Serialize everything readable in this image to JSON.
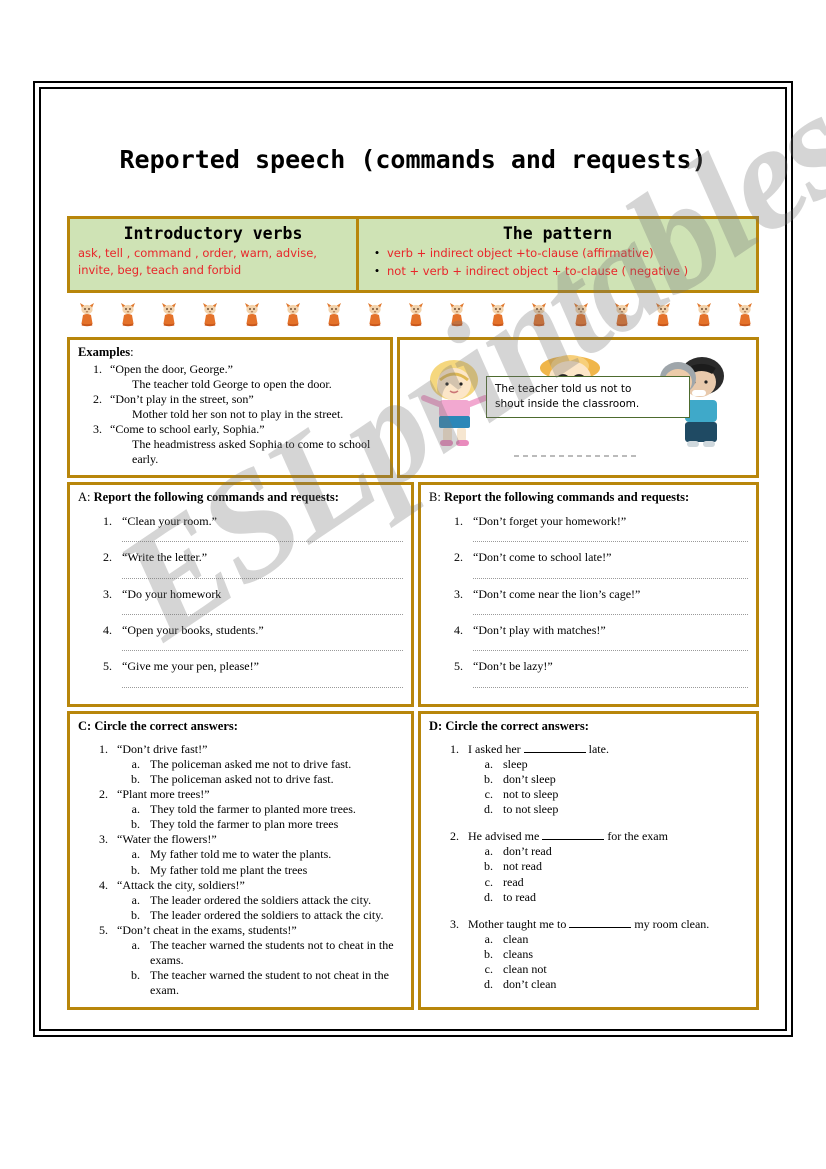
{
  "title": "Reported speech (commands and requests)",
  "watermark": "ESLprintables.com",
  "intro": {
    "verbs_heading": "Introductory verbs",
    "verbs_line1": "ask, tell , command , order, warn, advise,",
    "verbs_line2": "invite, beg, teach and forbid",
    "pattern_heading": "The pattern",
    "pattern_1": "verb + indirect object +to-clause (affirmative)",
    "pattern_2": "not + verb + indirect object + to-clause ( negative )",
    "bullet": "•",
    "verbs_color": "#e8262a",
    "box_bg": "#cfe3b5",
    "border_color": "#b8860b"
  },
  "examples": {
    "heading": "Examples",
    "heading_colon": ":",
    "items": [
      {
        "num": "1.",
        "quote": "“Open the door, George.”",
        "answer": "The teacher told George to open the door."
      },
      {
        "num": "2.",
        "quote": "“Don’t play in the street, son”",
        "answer": "Mother told her son not to play in the street."
      },
      {
        "num": "3.",
        "quote": "“Come to school early, Sophia.”",
        "answer": "The headmistress asked Sophia to come to school early."
      }
    ]
  },
  "picture": {
    "speech_line1": "The teacher told us not to",
    "speech_line2": "shout inside the classroom."
  },
  "section_a": {
    "letter": "A: ",
    "heading": "Report the following commands and requests:",
    "items": [
      {
        "num": "1.",
        "text": "“Clean your room.”"
      },
      {
        "num": "2.",
        "text": "“Write the letter.”"
      },
      {
        "num": "3.",
        "text": "“Do your homework"
      },
      {
        "num": "4.",
        "text": "“Open your books, students.”"
      },
      {
        "num": "5.",
        "text": "“Give me your pen, please!”"
      }
    ]
  },
  "section_b": {
    "letter": "B: ",
    "heading": "Report the following commands and requests:",
    "items": [
      {
        "num": "1.",
        "text": "“Don’t forget your homework!”"
      },
      {
        "num": "2.",
        "text": "“Don’t come to school late!”"
      },
      {
        "num": "3.",
        "text": "“Don’t come near the lion’s cage!”"
      },
      {
        "num": "4.",
        "text": "“Don’t play with matches!”"
      },
      {
        "num": "5.",
        "text": "“Don’t be lazy!”"
      }
    ]
  },
  "section_c": {
    "letter": "C: ",
    "heading": "Circle the correct answers:",
    "questions": [
      {
        "num": "1.",
        "prompt": "“Don’t drive fast!”",
        "options": [
          {
            "letter": "a.",
            "text": "The policeman asked me not to drive fast."
          },
          {
            "letter": "b.",
            "text": "The policeman asked not to drive fast."
          }
        ]
      },
      {
        "num": "2.",
        "prompt": "“Plant more trees!”",
        "options": [
          {
            "letter": "a.",
            "text": "They told the farmer to planted more trees."
          },
          {
            "letter": "b.",
            "text": "They told the farmer to plan more trees"
          }
        ]
      },
      {
        "num": "3.",
        "prompt": "“Water the flowers!”",
        "options": [
          {
            "letter": "a.",
            "text": "My father told me to water the plants."
          },
          {
            "letter": "b.",
            "text": "My father told me plant the trees"
          }
        ]
      },
      {
        "num": "4.",
        "prompt": "“Attack the city, soldiers!”",
        "options": [
          {
            "letter": "a.",
            "text": "The leader ordered the soldiers attack the city."
          },
          {
            "letter": "b.",
            "text": "The leader ordered the soldiers to attack the city."
          }
        ]
      },
      {
        "num": "5.",
        "prompt": "“Don’t cheat in the exams, students!”",
        "options": [
          {
            "letter": "a.",
            "text": "The teacher warned the students not to cheat in the exams."
          },
          {
            "letter": "b.",
            "text": "The teacher warned the student to not cheat in the exam."
          }
        ]
      }
    ]
  },
  "section_d": {
    "letter": "D: ",
    "heading": "Circle the correct answers:",
    "questions": [
      {
        "num": "1.",
        "prompt_before": "I asked her ",
        "prompt_after": " late.",
        "options": [
          {
            "letter": "a.",
            "text": "sleep"
          },
          {
            "letter": "b.",
            "text": "don’t sleep"
          },
          {
            "letter": "c.",
            "text": "not to sleep"
          },
          {
            "letter": "d.",
            "text": "to not sleep"
          }
        ]
      },
      {
        "num": "2.",
        "prompt_before": "He advised me ",
        "prompt_after": " for the exam",
        "options": [
          {
            "letter": "a.",
            "text": "don’t read"
          },
          {
            "letter": "b.",
            "text": "not read"
          },
          {
            "letter": "c.",
            "text": "read"
          },
          {
            "letter": "d.",
            "text": "to read"
          }
        ]
      },
      {
        "num": "3.",
        "prompt_before": "Mother taught me to ",
        "prompt_after": " my room clean.",
        "options": [
          {
            "letter": "a.",
            "text": "clean"
          },
          {
            "letter": "b.",
            "text": "cleans"
          },
          {
            "letter": "c.",
            "text": "clean not"
          },
          {
            "letter": "d.",
            "text": "don’t clean"
          }
        ]
      }
    ]
  }
}
